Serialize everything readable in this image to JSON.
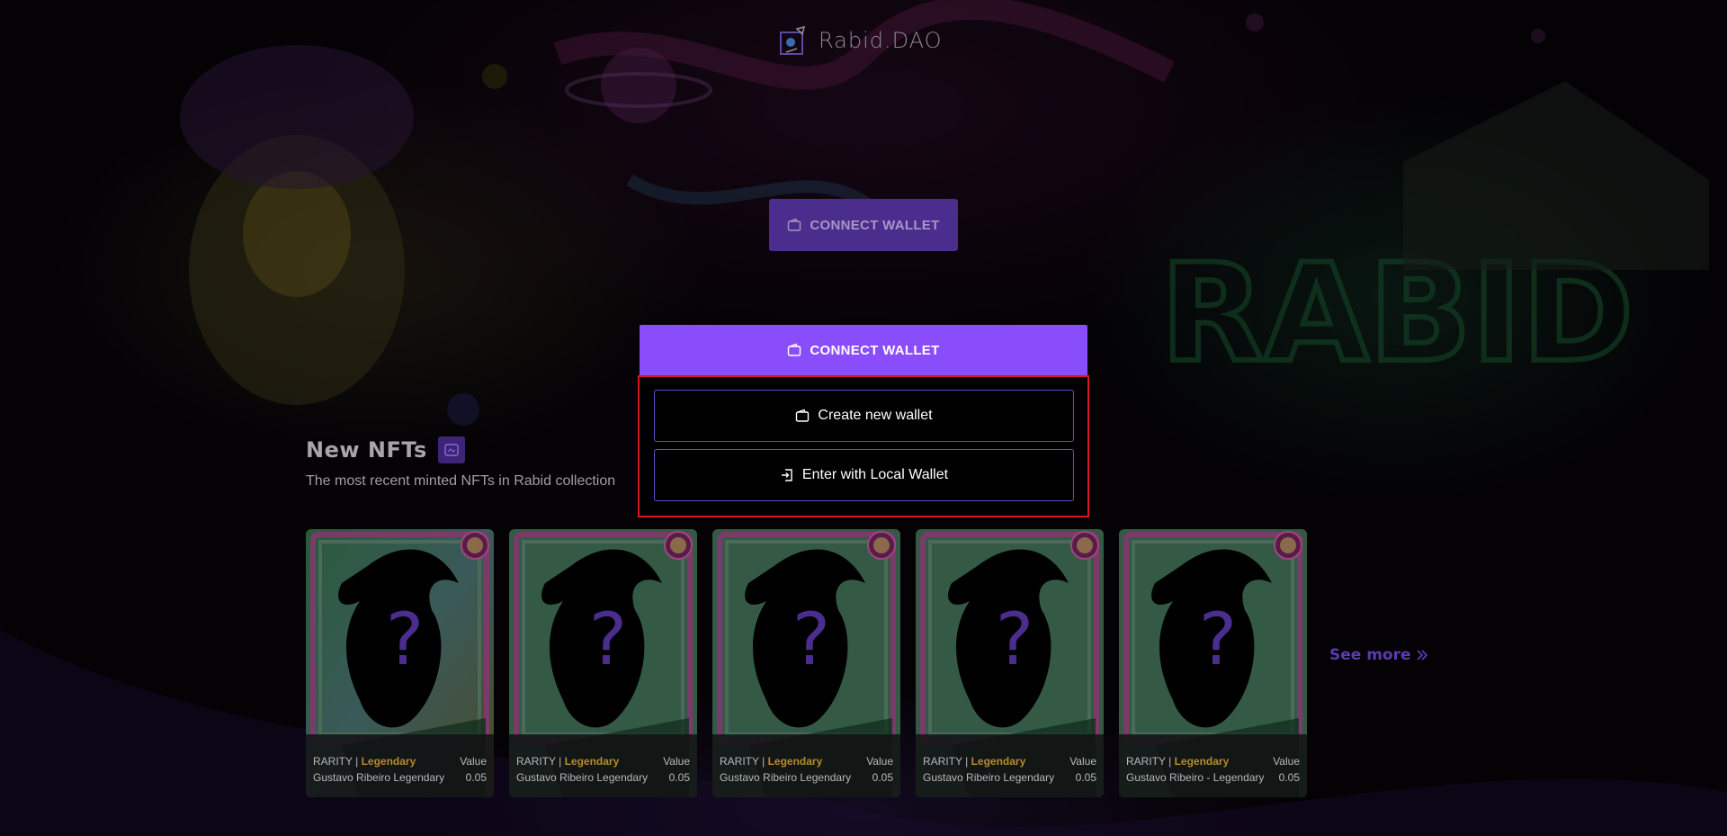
{
  "brand": {
    "name": "Rabid.DAO",
    "logo_icon": "rabid-logo-icon"
  },
  "header": {
    "connect_button_label": "CONNECT WALLET"
  },
  "wallet_menu": {
    "connect_label": "CONNECT WALLET",
    "options": [
      {
        "label": "Create new wallet",
        "icon": "wallet-icon"
      },
      {
        "label": "Enter with Local Wallet",
        "icon": "login-icon"
      }
    ]
  },
  "section": {
    "title": "New NFTs",
    "subtitle": "The most recent minted NFTs in Rabid collection"
  },
  "nfts": [
    {
      "rarity_label": "RARITY |",
      "rarity": "Legendary",
      "value_label": "Value",
      "name": "Gustavo Ribeiro Legendary",
      "value": "0.05"
    },
    {
      "rarity_label": "RARITY |",
      "rarity": "Legendary",
      "value_label": "Value",
      "name": "Gustavo Ribeiro Legendary",
      "value": "0.05"
    },
    {
      "rarity_label": "RARITY |",
      "rarity": "Legendary",
      "value_label": "Value",
      "name": "Gustavo Ribeiro Legendary",
      "value": "0.05"
    },
    {
      "rarity_label": "RARITY |",
      "rarity": "Legendary",
      "value_label": "Value",
      "name": "Gustavo Ribeiro Legendary",
      "value": "0.05"
    },
    {
      "rarity_label": "RARITY |",
      "rarity": "Legendary",
      "value_label": "Value",
      "name": "Gustavo Ribeiro - Legendary",
      "value": "0.05"
    }
  ],
  "see_more_label": "See more",
  "colors": {
    "accent": "#8a4dfb",
    "accent_dim": "#4a2d8c",
    "highlight_border": "#e0141e",
    "rarity": "#b98a2c"
  }
}
